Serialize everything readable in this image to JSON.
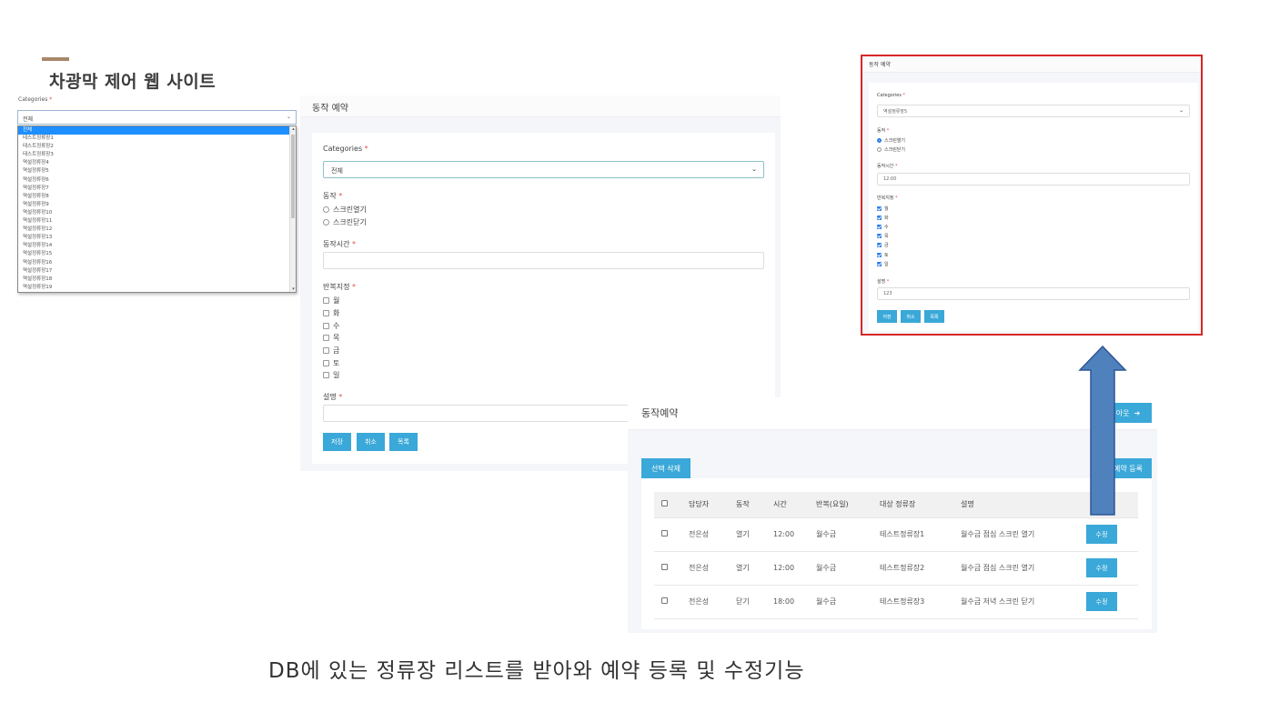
{
  "slide": {
    "title": "차광막 제어 웹 사이트",
    "caption": "DB에 있는 정류장 리스트를 받아와 예약 등록 및 수정기능"
  },
  "dropdown_panel": {
    "label": "Categories",
    "selected": "전체",
    "options": [
      "전체",
      "테스트정류장1",
      "테스트정류장2",
      "테스트정류장3",
      "역설정류장4",
      "역설정류장5",
      "역설정류장6",
      "역설정류장7",
      "역설정류장8",
      "역설정류장9",
      "역설정류장10",
      "역설정류장11",
      "역설정류장12",
      "역설정류장13",
      "역설정류장14",
      "역설정류장15",
      "역설정류장16",
      "역설정류장17",
      "역설정류장18",
      "역설정류장19"
    ]
  },
  "form": {
    "title": "동작 예약",
    "categories_label": "Categories",
    "categories_value": "전체",
    "action_label": "동작",
    "action_options": [
      "스크린열기",
      "스크린닫기"
    ],
    "time_label": "동작시간",
    "repeat_label": "반복지정",
    "days": [
      "월",
      "화",
      "수",
      "목",
      "금",
      "토",
      "일"
    ],
    "desc_label": "설명",
    "save": "저장",
    "cancel": "취소",
    "list": "목록"
  },
  "list_view": {
    "title": "동작예약",
    "logout": "아웃",
    "delete_selected": "선택 삭제",
    "register": "예약 등록",
    "headers": [
      "담당자",
      "동작",
      "시간",
      "반복(요일)",
      "대상 정류장",
      "설명"
    ],
    "edit_label": "수정",
    "rows": [
      {
        "manager": "전은성",
        "action": "열기",
        "time": "12:00",
        "repeat": "월수금",
        "stop": "테스트정류장1",
        "desc": "월수금 점심 스크린 열기"
      },
      {
        "manager": "전은성",
        "action": "열기",
        "time": "12:00",
        "repeat": "월수금",
        "stop": "테스트정류장2",
        "desc": "월수금 점심 스크린 열기"
      },
      {
        "manager": "전은성",
        "action": "닫기",
        "time": "18:00",
        "repeat": "월수금",
        "stop": "테스트정류장3",
        "desc": "월수금 저녁 스크린 닫기"
      }
    ]
  },
  "filled_form": {
    "title": "동작 예약",
    "categories_label": "Categories",
    "categories_value": "역설정류장5",
    "action_label": "동작",
    "action_options": [
      "스크린열기",
      "스크린닫기"
    ],
    "action_selected": "스크린열기",
    "time_label": "동작시간",
    "time_value": "12:00",
    "repeat_label": "반복지정",
    "days": [
      "월",
      "화",
      "수",
      "목",
      "금",
      "토",
      "일"
    ],
    "desc_label": "설명",
    "desc_value": "123",
    "save": "저장",
    "cancel": "취소",
    "list": "목록"
  },
  "colors": {
    "accent": "#3aa8d8",
    "highlight_border": "#d62728",
    "arrow": "#4f81bd",
    "title_bar": "#a8876a"
  }
}
